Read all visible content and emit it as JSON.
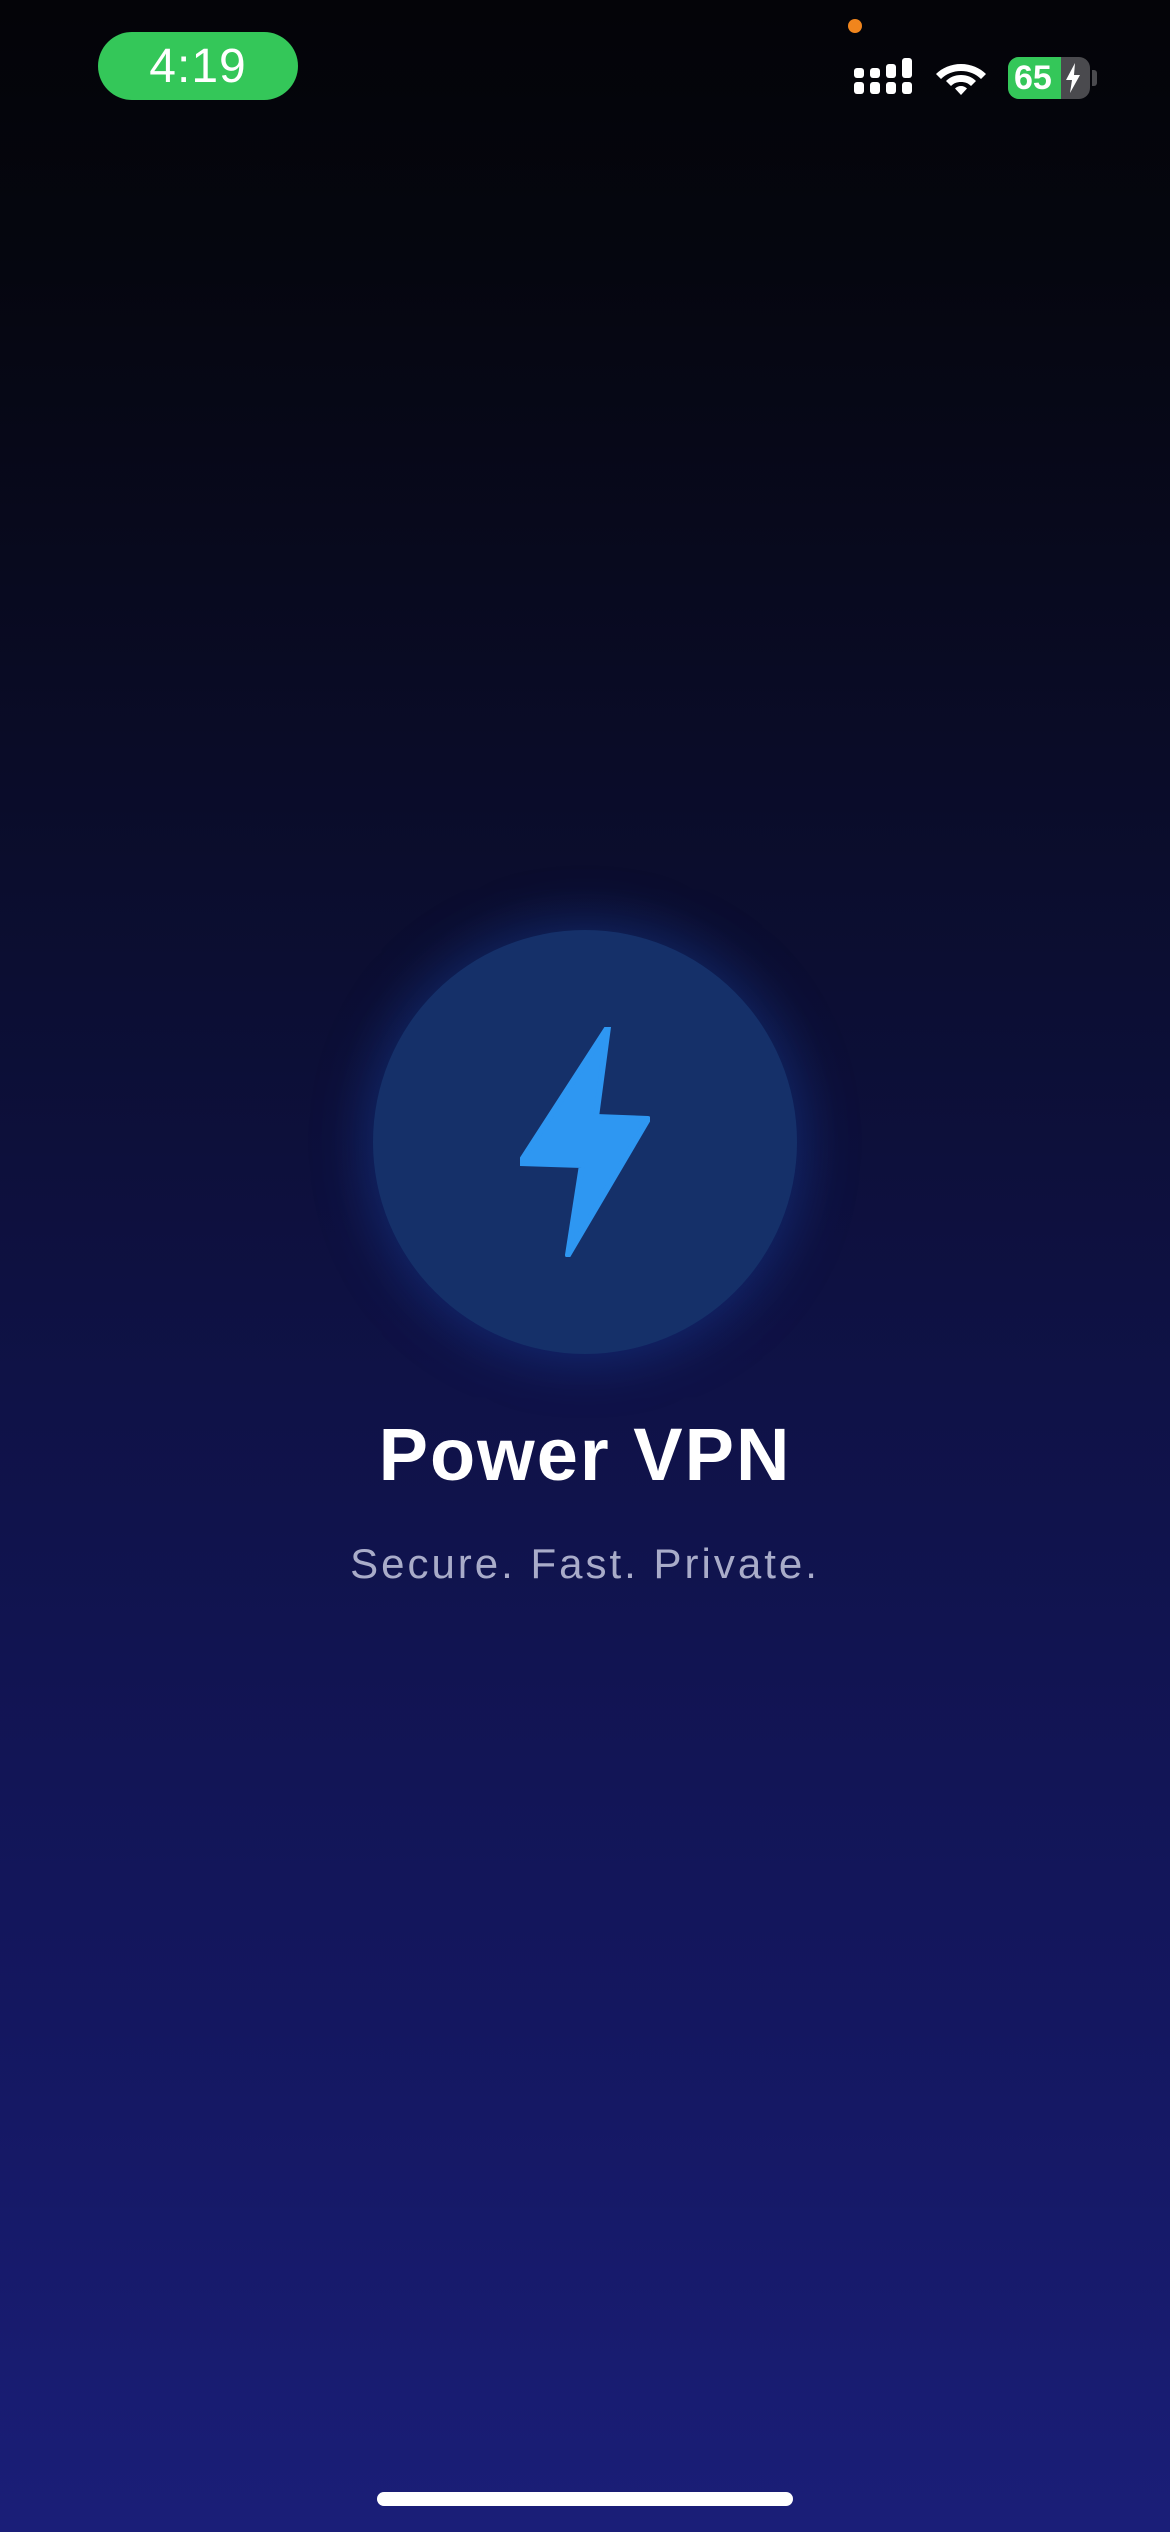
{
  "status_bar": {
    "time": "4:19",
    "battery_level": "65",
    "battery_charging": true,
    "icons": [
      "signal-icon",
      "wifi-icon",
      "battery-icon",
      "charging-bolt-icon"
    ]
  },
  "app": {
    "logo_icon": "lightning-bolt-icon",
    "title": "Power VPN",
    "tagline": "Secure. Fast. Private."
  },
  "colors": {
    "time_pill": "#34c759",
    "privacy_dot": "#f0851d",
    "battery_fill": "#34c759",
    "logo_circle": "#153069",
    "bolt": "#2e97f2",
    "tagline": "#a9acc9"
  }
}
